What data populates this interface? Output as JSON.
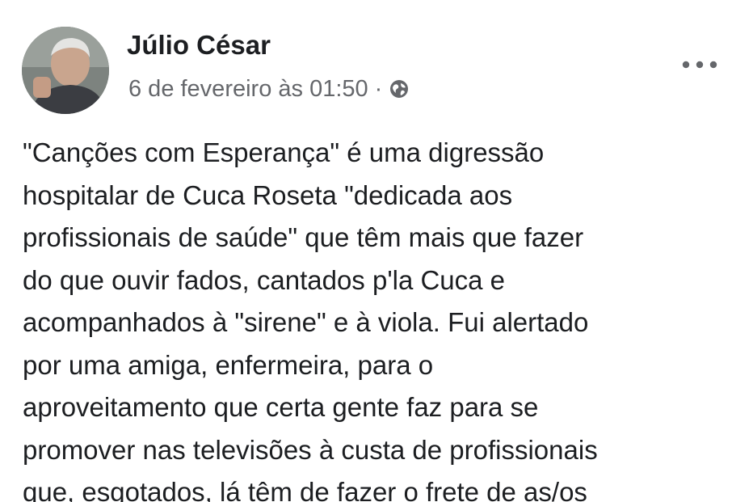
{
  "post": {
    "author": "Júlio César",
    "timestamp": "6 de fevereiro às 01:50",
    "separator": "·",
    "privacy_icon": "globe-icon",
    "more_icon": "more-options-icon",
    "text_lines": [
      "\"Canções com Esperança\" é uma digressão",
      "hospitalar de Cuca Roseta \"dedicada aos",
      "profissionais de saúde\" que têm mais que fazer",
      "do que ouvir fados, cantados p'la Cuca e",
      "acompanhados à \"sirene\" e à viola. Fui alertado",
      "por uma amiga, enfermeira, para o",
      "aproveitamento que certa gente faz para se",
      "promover nas televisões à custa de profissionais",
      "que, esgotados, lá têm de fazer o frete de as/os"
    ]
  },
  "colors": {
    "text_primary": "#1c1e21",
    "text_secondary": "#65676b",
    "background": "#ffffff"
  }
}
